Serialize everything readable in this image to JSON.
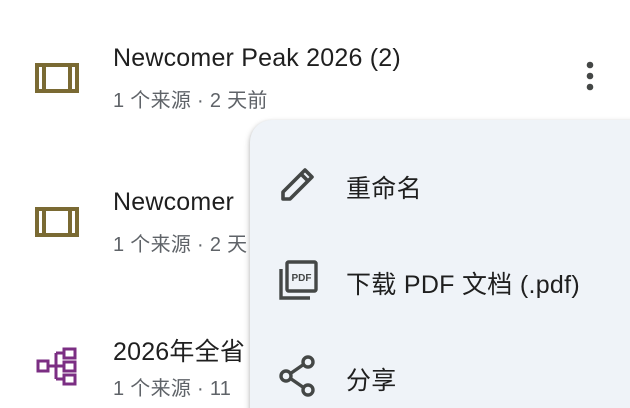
{
  "list": {
    "items": [
      {
        "title": "Newcomer Peak 2026 (2)",
        "meta": "1 个来源 · 2 天前",
        "icon": "slides-icon"
      },
      {
        "title": "Newcomer",
        "meta": "1 个来源 · 2 天",
        "icon": "slides-icon"
      },
      {
        "title": "2026年全省",
        "meta": "1 个来源 · 11",
        "icon": "mindmap-icon"
      }
    ]
  },
  "menu": {
    "items": [
      {
        "label": "重命名",
        "icon": "pencil-icon"
      },
      {
        "label": "下载 PDF 文档 (.pdf)",
        "icon": "pdf-icon"
      },
      {
        "label": "分享",
        "icon": "share-icon"
      }
    ]
  },
  "icons": {
    "pdf_badge": "PDF"
  },
  "colors": {
    "slides_icon": "#7a6a33",
    "mindmap_icon": "#7b2e83",
    "text_primary": "#1f1f1f",
    "text_secondary": "#5f6368",
    "menu_background": "#eff3f8"
  }
}
